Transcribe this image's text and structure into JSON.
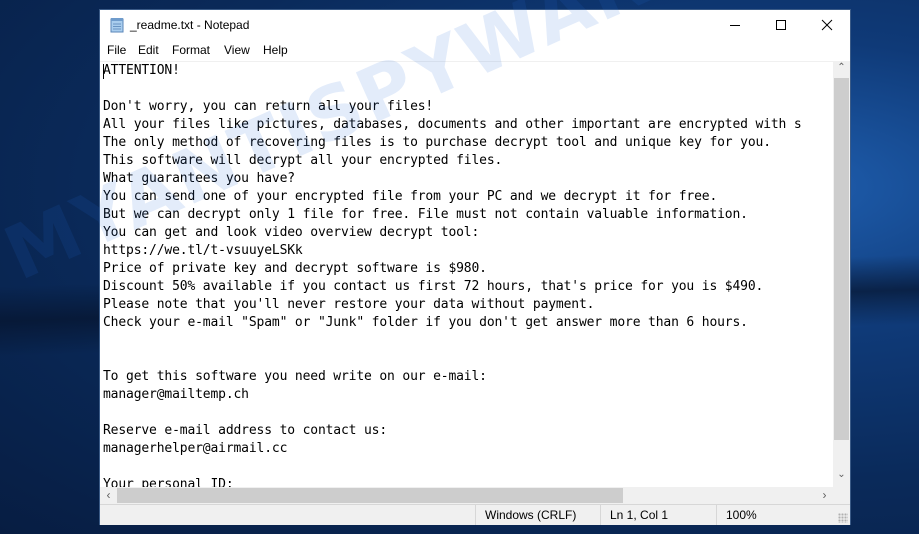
{
  "window": {
    "title": "_readme.txt - Notepad",
    "controls": {
      "minimize": "minimize",
      "maximize": "maximize",
      "close": "close"
    }
  },
  "menu": [
    "File",
    "Edit",
    "Format",
    "View",
    "Help"
  ],
  "document": {
    "lines": [
      "ATTENTION!",
      "",
      "Don't worry, you can return all your files!",
      "All your files like pictures, databases, documents and other important are encrypted with s",
      "The only method of recovering files is to purchase decrypt tool and unique key for you.",
      "This software will decrypt all your encrypted files.",
      "What guarantees you have?",
      "You can send one of your encrypted file from your PC and we decrypt it for free.",
      "But we can decrypt only 1 file for free. File must not contain valuable information.",
      "You can get and look video overview decrypt tool:",
      "https://we.tl/t-vsuuyeLSKk",
      "Price of private key and decrypt software is $980.",
      "Discount 50% available if you contact us first 72 hours, that's price for you is $490.",
      "Please note that you'll never restore your data without payment.",
      "Check your e-mail \"Spam\" or \"Junk\" folder if you don't get answer more than 6 hours.",
      "",
      "",
      "To get this software you need write on our e-mail:",
      "manager@mailtemp.ch",
      "",
      "Reserve e-mail address to contact us:",
      "managerhelper@airmail.cc",
      "",
      "Your personal ID:"
    ]
  },
  "statusbar": {
    "line_ending": "Windows (CRLF)",
    "position": "Ln 1, Col 1",
    "zoom": "100%"
  },
  "scroll": {
    "vertical_position_percent": 0,
    "horizontal_position_percent": 0
  },
  "watermark": "MYANTISPYWARE.COM",
  "colors": {
    "desktop": "#0a2a5a",
    "window_bg": "#ffffff",
    "chrome_bg": "#f0f0f0",
    "scroll_thumb": "#cdcdcd"
  }
}
